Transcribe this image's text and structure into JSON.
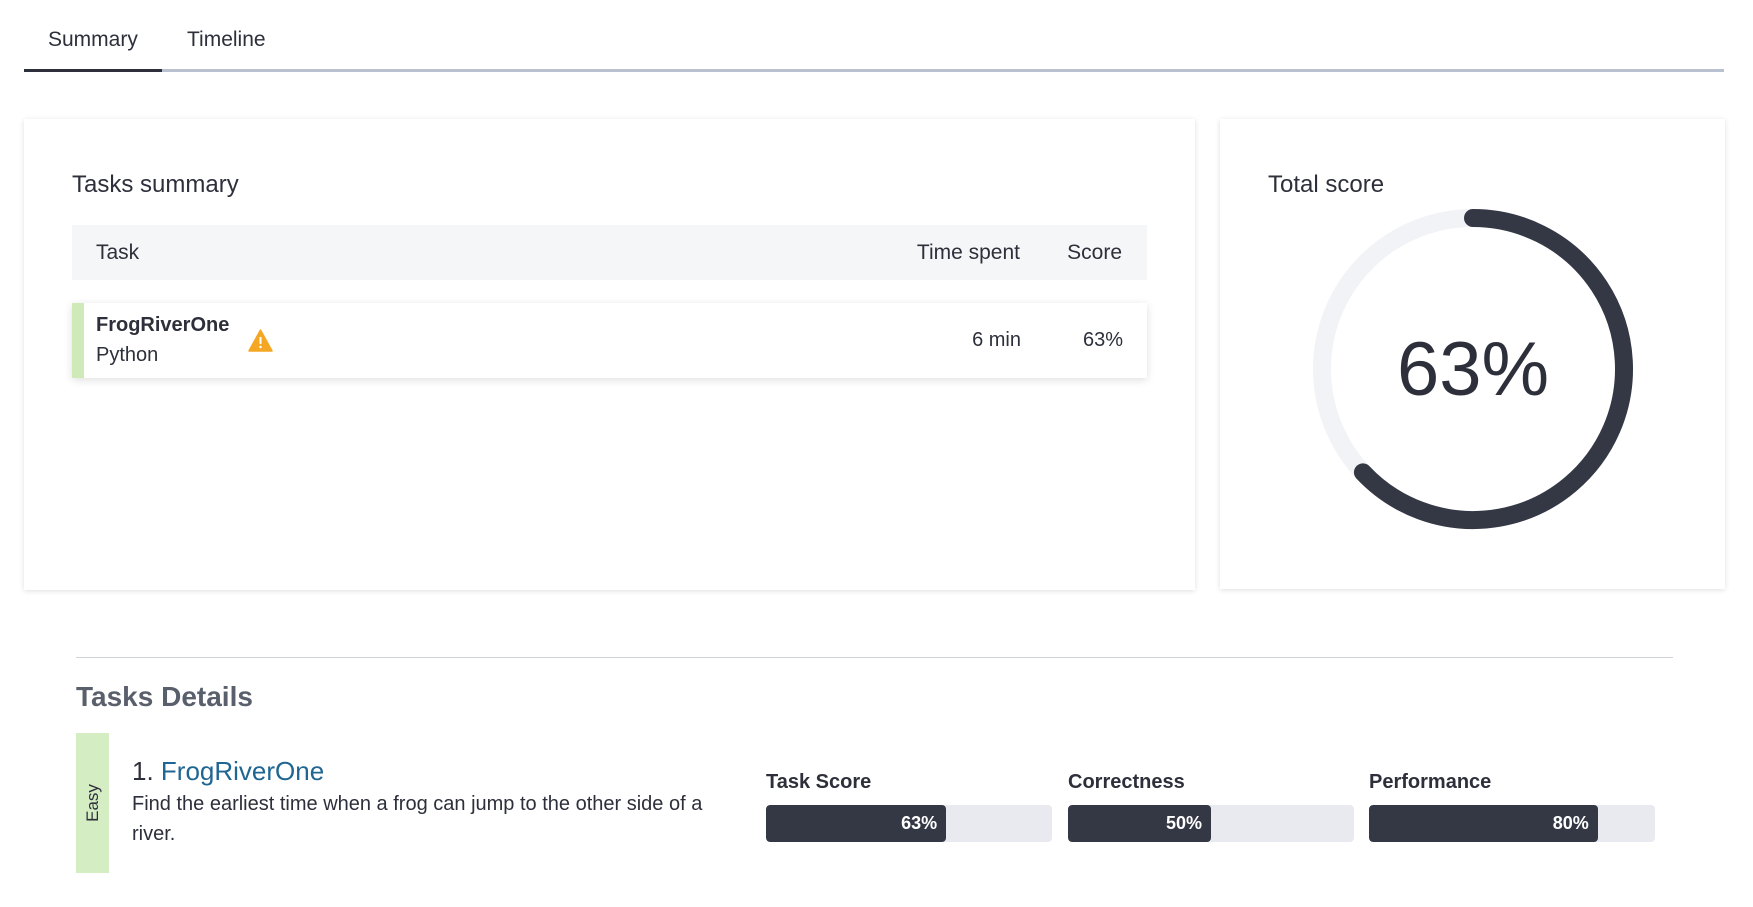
{
  "tabs": [
    {
      "label": "Summary",
      "active": true
    },
    {
      "label": "Timeline",
      "active": false
    }
  ],
  "tasks_summary": {
    "title": "Tasks summary",
    "columns": {
      "task": "Task",
      "time": "Time spent",
      "score": "Score"
    },
    "rows": [
      {
        "name": "FrogRiverOne",
        "language": "Python",
        "time": "6 min",
        "score": "63%",
        "warning_icon": "warning-icon"
      }
    ]
  },
  "total_score": {
    "title": "Total score",
    "value": "63%",
    "percent": 63,
    "track_color": "#f2f3f6",
    "fill_color": "#343845"
  },
  "details": {
    "title": "Tasks Details",
    "tasks": [
      {
        "difficulty": "Easy",
        "index": "1.",
        "name": "FrogRiverOne",
        "description": "Find the earliest time when a frog can jump to the other side of a river.",
        "metrics": [
          {
            "label": "Task Score",
            "value": "63%",
            "percent": 63
          },
          {
            "label": "Correctness",
            "value": "50%",
            "percent": 50
          },
          {
            "label": "Performance",
            "value": "80%",
            "percent": 80
          }
        ]
      }
    ]
  },
  "colors": {
    "accent_dark": "#343845",
    "link": "#1f6692",
    "easy": "#d5edc3",
    "warning": "#f5a623"
  }
}
